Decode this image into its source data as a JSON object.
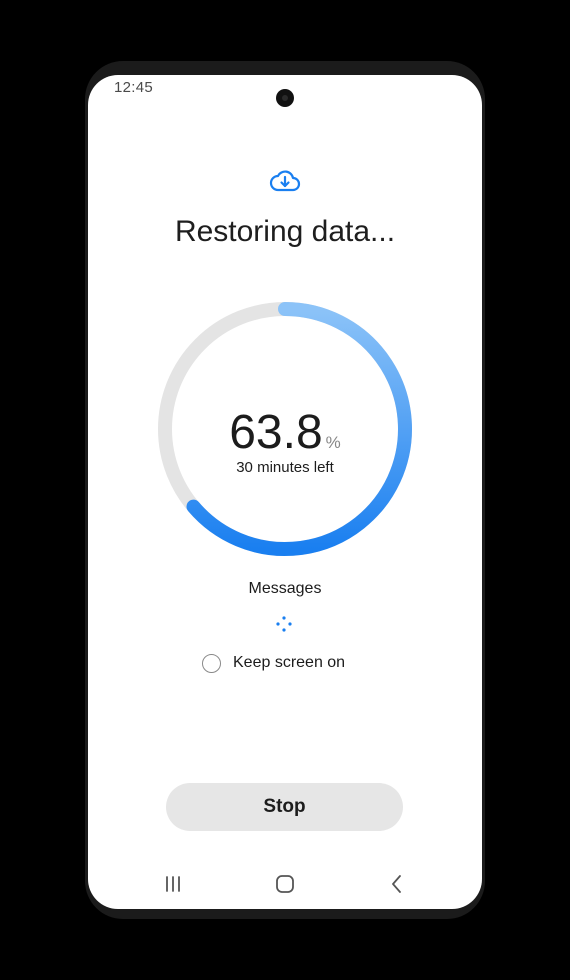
{
  "status_bar": {
    "time": "12:45"
  },
  "header": {
    "icon": "cloud-download-icon",
    "title": "Restoring data..."
  },
  "progress": {
    "percent": 63.8,
    "percent_text": "63.8",
    "percent_sign": "%",
    "time_left": "30 minutes left",
    "current_item": "Messages"
  },
  "options": {
    "keep_screen_on_label": "Keep screen on",
    "keep_screen_on_checked": false
  },
  "actions": {
    "stop_label": "Stop"
  },
  "nav": {
    "recents": "recents-icon",
    "home": "home-icon",
    "back": "back-icon"
  },
  "colors": {
    "accent": "#1a7ff0",
    "accent_light": "#8cc3f8",
    "track": "#e4e4e4"
  }
}
